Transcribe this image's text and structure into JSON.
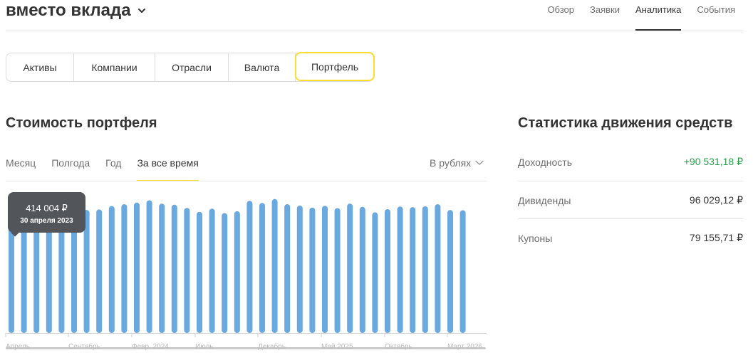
{
  "header": {
    "title": "вместо вклада",
    "nav": [
      "Обзор",
      "Заявки",
      "Аналитика",
      "События"
    ],
    "active_nav": "Аналитика"
  },
  "segments": {
    "items": [
      "Активы",
      "Компании",
      "Отрасли",
      "Валюта",
      "Портфель"
    ],
    "active": "Портфель"
  },
  "portfolio": {
    "title": "Стоимость портфеля",
    "periods": [
      "Месяц",
      "Полгода",
      "Год",
      "За все время"
    ],
    "active_period": "За все время",
    "currency_select": "В рублях",
    "tooltip": {
      "value": "414 004 ₽",
      "date": "30 апреля 2023"
    }
  },
  "stats": {
    "title": "Статистика движения средств",
    "rows": [
      {
        "label": "Доходность",
        "value": "+90 531,18 ₽",
        "positive": true
      },
      {
        "label": "Дивиденды",
        "value": "96 029,12 ₽",
        "positive": false
      },
      {
        "label": "Купоны",
        "value": "79 155,71 ₽",
        "positive": false
      }
    ]
  },
  "colors": {
    "accent": "#ffdd2d",
    "bar": "#6aa9e0",
    "positive": "#26a04a",
    "tooltip": "#52555a"
  },
  "chart_data": {
    "type": "bar",
    "categories": [
      "Апрель",
      "",
      "",
      "",
      "",
      "Сентябрь",
      "",
      "",
      "",
      "",
      "Февр. 2024",
      "",
      "",
      "",
      "",
      "Июль",
      "",
      "",
      "",
      "",
      "Декабрь",
      "",
      "",
      "",
      "",
      "Май 2025",
      "",
      "",
      "",
      "",
      "Октябрь",
      "",
      "",
      "",
      "",
      "Март 2026",
      "",
      "",
      ""
    ],
    "x_tick_labels": [
      "Апрель",
      "Сентябрь",
      "Февр. 2024",
      "Июль",
      "Декабрь",
      "Май 2025",
      "Октябрь",
      "Март 2026"
    ],
    "values": [
      414004,
      422000,
      438000,
      445000,
      455000,
      462000,
      470000,
      472000,
      485000,
      492000,
      498000,
      507000,
      494000,
      490000,
      478000,
      463000,
      475000,
      458000,
      465000,
      505000,
      497000,
      512000,
      492000,
      487000,
      479000,
      486000,
      477000,
      494000,
      482000,
      461000,
      473000,
      483000,
      481000,
      484000,
      492000,
      470000,
      469000
    ],
    "ylim": [
      0,
      560000
    ],
    "grid": false,
    "legend": "none"
  }
}
